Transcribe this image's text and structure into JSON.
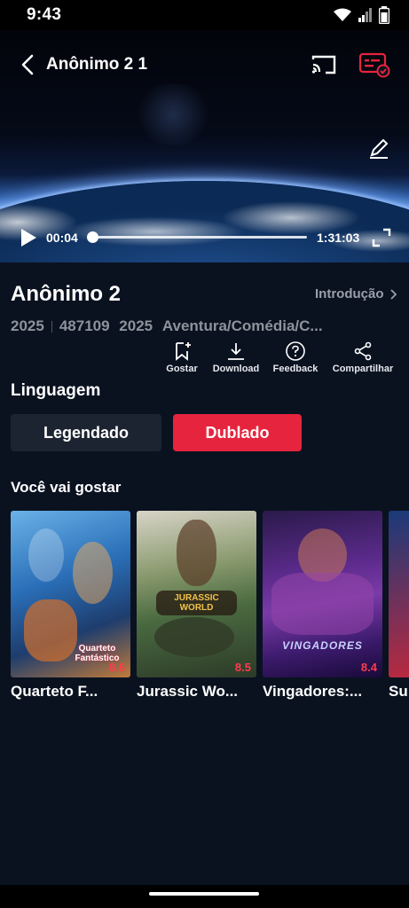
{
  "status_bar": {
    "time": "9:43"
  },
  "player": {
    "title": "Anônimo 2 1",
    "current_time": "00:04",
    "total_time": "1:31:03",
    "progress_fraction": 0.003
  },
  "details": {
    "title": "Anônimo 2",
    "intro_label": "Introdução",
    "year": "2025",
    "views": "487109",
    "year2": "2025",
    "genres": "Aventura/Comédia/C..."
  },
  "actions": [
    {
      "label": "Gostar",
      "icon": "bookmark-add-icon"
    },
    {
      "label": "Download",
      "icon": "download-icon"
    },
    {
      "label": "Feedback",
      "icon": "question-icon"
    },
    {
      "label": "Compartilhar",
      "icon": "share-icon"
    }
  ],
  "language": {
    "title": "Linguagem",
    "options": [
      "Legendado",
      "Dublado"
    ],
    "selected": "Dublado"
  },
  "recommendations": {
    "title": "Você vai gostar",
    "items": [
      {
        "name": "Quarteto F...",
        "rating": "8.6",
        "poster_text": "Quarteto Fantástico"
      },
      {
        "name": "Jurassic Wo...",
        "rating": "8.5",
        "poster_text": "JURASSIC WORLD"
      },
      {
        "name": "Vingadores:...",
        "rating": "8.4",
        "poster_text": "VINGADORES"
      },
      {
        "name": "Su",
        "rating": ""
      }
    ]
  },
  "colors": {
    "accent": "#e6243e",
    "background": "#0a1220",
    "secondary_button": "#1d2431"
  }
}
